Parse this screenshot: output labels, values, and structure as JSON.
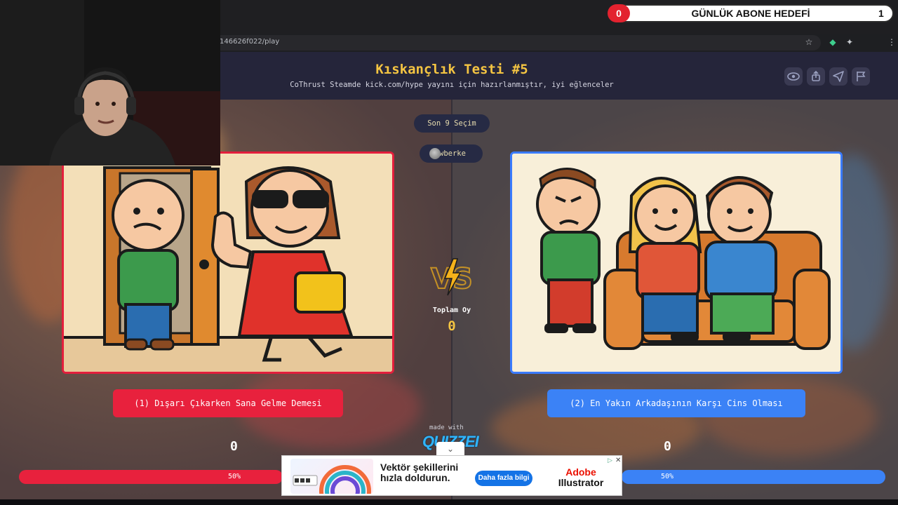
{
  "browser": {
    "url": "146626f022/play"
  },
  "overlay": {
    "goal_label": "GÜNLÜK ABONE HEDEFİ",
    "goal_current": "0",
    "goal_target": "1"
  },
  "header": {
    "title": "Kıskançlık Testi #5",
    "subtitle": "CoThrust Steamde kick.com/hype yayını için hazırlanmıştır, iyi eğlenceler",
    "buttons": [
      "eye-icon",
      "share-icon",
      "send-icon",
      "flag-icon"
    ]
  },
  "game": {
    "last_choices": "Son 9 Seçim",
    "voter": "wberke",
    "total_votes_label": "Toplam Oy",
    "total_votes": "0",
    "options": [
      {
        "label": "(1) Dışarı Çıkarken Sana Gelme Demesi",
        "score": "0",
        "percent": "50%",
        "color": "#e8213d"
      },
      {
        "label": "(2) En Yakın Arkadaşının Karşı Cins Olması",
        "score": "0",
        "percent": "50%",
        "color": "#3b82f6"
      }
    ],
    "made_with": "made with",
    "brand": "QUIZZEI"
  },
  "ad": {
    "headline": "Vektör şekillerini hızla doldurun.",
    "cta": "Daha fazla bilgi",
    "brand_line1": "Adobe",
    "brand_line2": "Illustrator"
  }
}
